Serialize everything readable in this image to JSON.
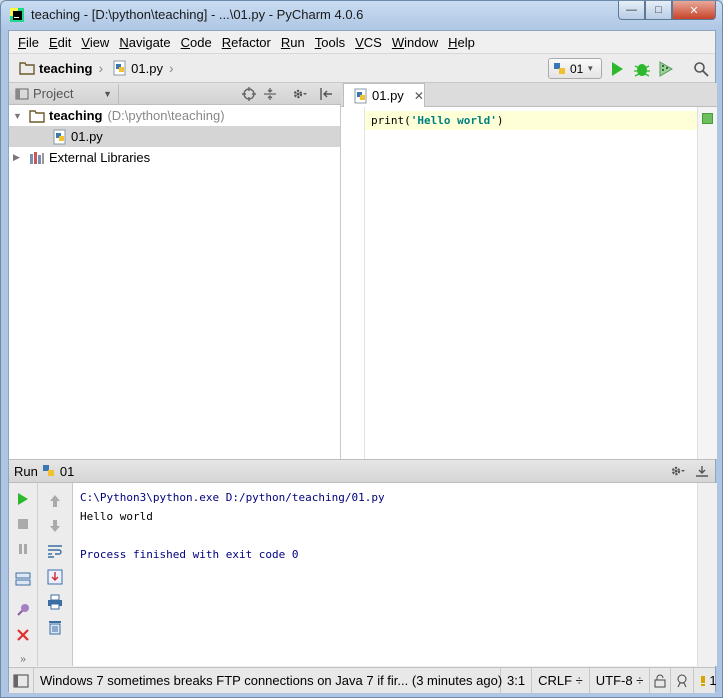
{
  "window": {
    "title": "teaching - [D:\\python\\teaching] - ...\\01.py - PyCharm 4.0.6",
    "minimize_glyph": "—",
    "maximize_glyph": "□",
    "close_glyph": "✕"
  },
  "menu": [
    {
      "u": "F",
      "rest": "ile"
    },
    {
      "u": "E",
      "rest": "dit"
    },
    {
      "u": "V",
      "rest": "iew"
    },
    {
      "u": "N",
      "rest": "avigate"
    },
    {
      "u": "C",
      "rest": "ode"
    },
    {
      "u": "R",
      "rest": "efactor"
    },
    {
      "u": "R",
      "rest": "un"
    },
    {
      "u": "T",
      "rest": "ools"
    },
    {
      "u": "V",
      "rest": "CS"
    },
    {
      "u": "W",
      "rest": "indow"
    },
    {
      "u": "H",
      "rest": "elp"
    }
  ],
  "navbar": {
    "crumb_project": "teaching",
    "crumb_file": "01.py",
    "run_config": "01"
  },
  "project_pane": {
    "view_label": "Project",
    "tree": [
      {
        "label": "teaching",
        "hint": "(D:\\python\\teaching)"
      },
      {
        "label": "01.py"
      },
      {
        "label": "External Libraries"
      }
    ]
  },
  "editor": {
    "tab_label": "01.py",
    "code_prefix": "print(",
    "code_string": "'Hello world'",
    "code_suffix": ")"
  },
  "run_panel": {
    "title": "Run",
    "config": "01",
    "console": [
      "C:\\Python3\\python.exe D:/python/teaching/01.py",
      "Hello world",
      "",
      "Process finished with exit code 0"
    ]
  },
  "status_bar": {
    "message": "Windows 7 sometimes breaks FTP connections on Java 7 if fir... (3 minutes ago)",
    "position": "3:1",
    "line_sep": "CRLF ÷",
    "encoding": "UTF-8 ÷",
    "event_count": "1"
  },
  "colors": {
    "run_green": "#2eb82e",
    "stop_red": "#e03030",
    "string_teal": "#008080",
    "console_blue": "#00007f",
    "current_line": "#ffffd7"
  }
}
